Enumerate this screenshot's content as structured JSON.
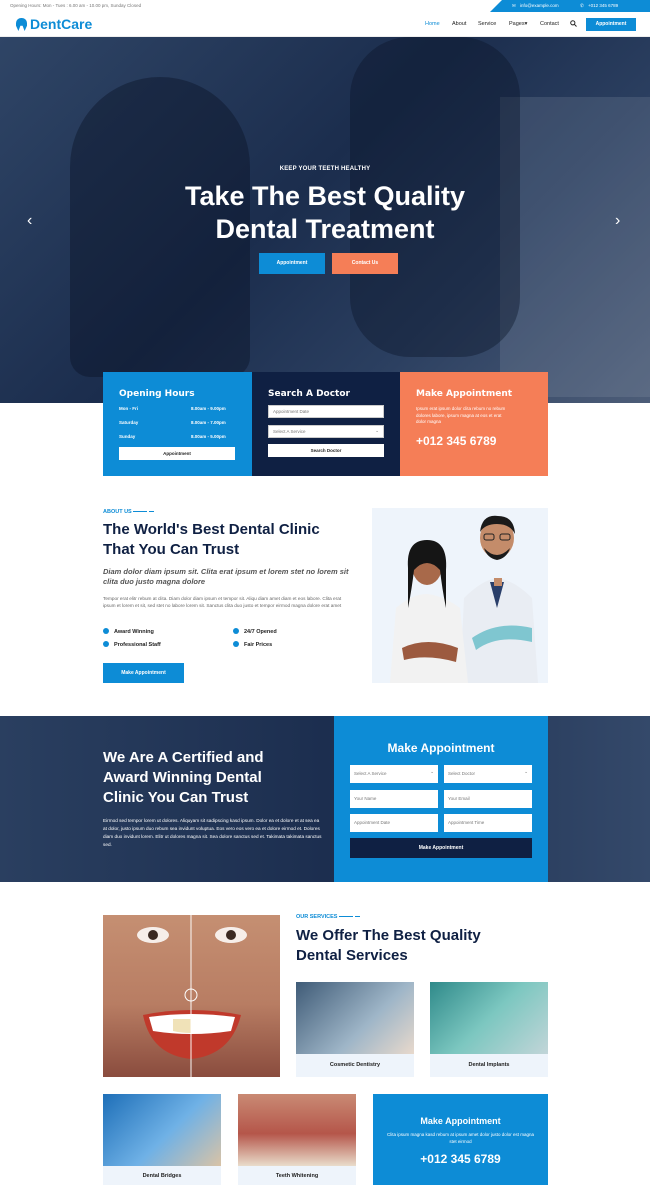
{
  "topbar": {
    "hours": "Opening Hours: Mon - Tues : 6.00 am - 10.00 pm, Sunday Closed",
    "email": "info@example.com",
    "phone": "+012 345 6789"
  },
  "nav": {
    "logo": "DentCare",
    "items": [
      "Home",
      "About",
      "Service",
      "Pages",
      "Contact"
    ],
    "pages_caret": "▾",
    "cta": "Appointment"
  },
  "hero": {
    "kicker": "KEEP YOUR TEETH HEALTHY",
    "title_line1": "Take The Best Quality",
    "title_line2": "Dental Treatment",
    "btn_primary": "Appointment",
    "btn_secondary": "Contact Us",
    "prev": "‹",
    "next": "›"
  },
  "hours_card": {
    "title": "Opening Hours",
    "rows": [
      {
        "day": "Mon - Fri",
        "time": "8.00am - 9.00pm"
      },
      {
        "day": "Saturday",
        "time": "8.00am - 7.00pm"
      },
      {
        "day": "Sunday",
        "time": "8.00am - 5.00pm"
      }
    ],
    "button": "Appointment"
  },
  "search_card": {
    "title": "Search A Doctor",
    "date_placeholder": "Appointment Date",
    "service_select": "Select A Service",
    "button": "Search Doctor"
  },
  "make_card": {
    "title": "Make Appointment",
    "text": "Ipsum erat ipsum dolor clita rebum no rebum dolores labore, ipsum magna at eos et erat dolor magna",
    "phone": "+012 345 6789"
  },
  "about": {
    "label": "ABOUT US",
    "title_line1": "The World's Best Dental Clinic",
    "title_line2": "That You Can Trust",
    "italic": "Diam dolor diam ipsum sit. Clita erat ipsum et lorem stet no lorem sit clita duo justo magna dolore",
    "para": "Tempor erat elitr rebum at clita. Diam dolor diam ipsum et tempor sit. Aliqu diam amet diam et eos labore. Clita erat ipsum et lorem et sit, sed stet no labore lorem sit. Sanctus clita duo justo et tempor eirmod magna dolore erat amet",
    "features": [
      "Award Winning",
      "24/7 Opened",
      "Professional Staff",
      "Fair Prices"
    ],
    "button": "Make Appointment"
  },
  "certified": {
    "title_line1": "We Are A Certified and",
    "title_line2": "Award Winning Dental",
    "title_line3": "Clinic You Can Trust",
    "para": "Eirmod sed tempor lorem ut dolores. Aliquyam sit sadipscing kasd ipsum. Dolor ea et dolore et at sea ea at dolor, justo ipsum duo rebum sea invidunt voluptua. Eos vero eos vero ea et dolore eirmod et. Dolores diam duo invidunt lorem. Elitr ut dolores magna sit. Sea dolore sanctus sed et. Takimata takimata sanctus sed.",
    "form_title": "Make Appointment",
    "select_service": "Select A Service",
    "select_doctor": "Select Doctor",
    "name": "Your Name",
    "email": "Your Email",
    "date": "Appointment Date",
    "time": "Appointment Time",
    "button": "Make Appointment"
  },
  "services": {
    "label": "OUR SERVICES",
    "title_line1": "We Offer The Best Quality",
    "title_line2": "Dental Services",
    "items": [
      "Cosmetic Dentistry",
      "Dental Implants",
      "Dental Bridges",
      "Teeth Whitening"
    ],
    "cta_title": "Make Appointment",
    "cta_text": "Clita ipsum magna kasd rebum at ipsum amet dolor justo dolor est magna stet eirmod",
    "cta_phone": "+012 345 6789"
  },
  "colors": {
    "primary": "#0D8CD6",
    "dark": "#0F2043",
    "orange": "#F57E57"
  }
}
